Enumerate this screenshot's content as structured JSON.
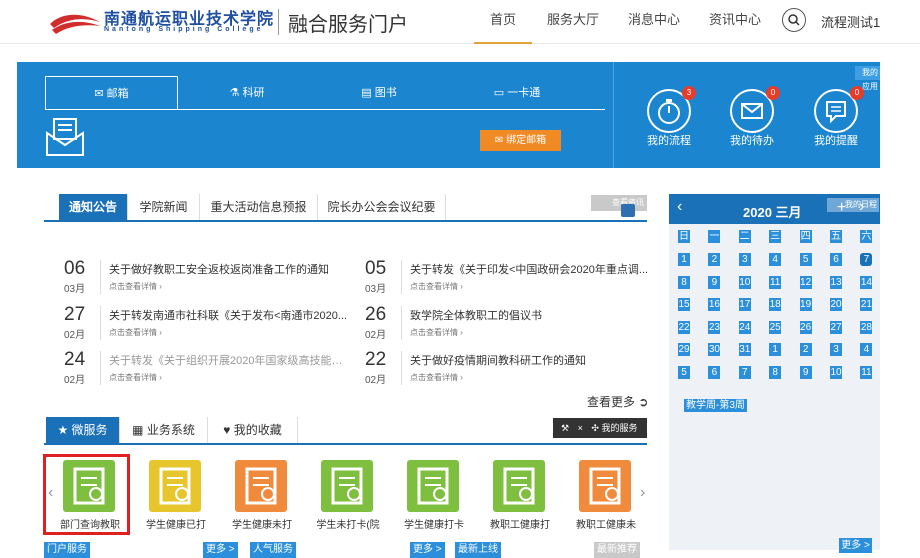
{
  "header": {
    "logo_cn": "南通航运职业技术学院",
    "logo_en": "Nantong Shipping College",
    "portal_title": "融合服务门户",
    "nav": [
      "首页",
      "服务大厅",
      "消息中心",
      "资讯中心"
    ],
    "user": "流程测试1"
  },
  "banner": {
    "tabs": [
      "邮箱",
      "科研",
      "图书",
      "一卡通"
    ],
    "bind_button": "绑定邮箱",
    "my_apps": "我的应用",
    "shortcuts": [
      {
        "label": "我的流程",
        "count": "3"
      },
      {
        "label": "我的待办",
        "count": "0"
      },
      {
        "label": "我的提醒",
        "count": "0"
      }
    ]
  },
  "notices": {
    "tabs": [
      "通知公告",
      "学院新闻",
      "重大活动信息预报",
      "院长办公会会议纪要"
    ],
    "more_overlay": "查看资讯",
    "detail_text": "点击查看详情 ›",
    "see_more": "查看更多",
    "items": [
      {
        "day": "06",
        "month": "03月",
        "title": "关于做好教职工安全返校返岗准备工作的通知",
        "grey": false
      },
      {
        "day": "05",
        "month": "03月",
        "title": "关于转发《关于印发<中国政研会2020年重点调...",
        "grey": false
      },
      {
        "day": "27",
        "month": "02月",
        "title": "关于转发南通市社科联《关于发布<南通市2020...",
        "grey": false
      },
      {
        "day": "26",
        "month": "02月",
        "title": "致学院全体教职工的倡议书",
        "grey": false
      },
      {
        "day": "24",
        "month": "02月",
        "title": "关于转发《关于组织开展2020年国家级高技能人...",
        "grey": true
      },
      {
        "day": "22",
        "month": "02月",
        "title": "关于做好疫情期间教科研工作的通知",
        "grey": false
      }
    ]
  },
  "calendar": {
    "title": "2020 三月",
    "overlay": "我的日程",
    "weekdays": [
      "日",
      "一",
      "二",
      "三",
      "四",
      "五",
      "六"
    ],
    "days": [
      "1",
      "2",
      "3",
      "4",
      "5",
      "6",
      "7",
      "8",
      "9",
      "10",
      "11",
      "12",
      "13",
      "14",
      "15",
      "16",
      "17",
      "18",
      "19",
      "20",
      "21",
      "22",
      "23",
      "24",
      "25",
      "26",
      "27",
      "28",
      "29",
      "30",
      "31",
      "1",
      "2",
      "3",
      "4",
      "5",
      "6",
      "7",
      "8",
      "9",
      "10",
      "11"
    ],
    "week_label": "教学周-第3周",
    "more": "更多 >"
  },
  "services": {
    "tabs": [
      "微服务",
      "业务系统",
      "我的收藏"
    ],
    "tools_label": "我的服务",
    "items": [
      {
        "label": "部门查询教职",
        "color": "#7fbf3f"
      },
      {
        "label": "学生健康已打",
        "color": "#e6c62c"
      },
      {
        "label": "学生健康未打",
        "color": "#f08a3c"
      },
      {
        "label": "学生未打卡(院",
        "color": "#7fbf3f"
      },
      {
        "label": "学生健康打卡",
        "color": "#7fbf3f"
      },
      {
        "label": "教职工健康打",
        "color": "#7fbf3f"
      },
      {
        "label": "教职工健康未",
        "color": "#f08a3c"
      }
    ],
    "bottom": [
      "门户服务",
      "更多 >",
      "人气服务",
      "更多 >",
      "最新上线",
      "最新推荐"
    ]
  }
}
